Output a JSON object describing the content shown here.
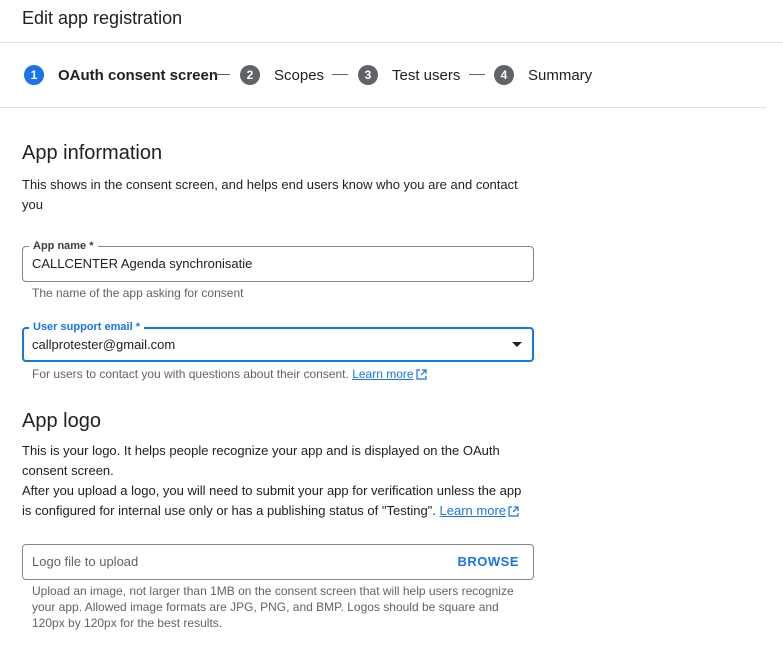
{
  "header": {
    "title": "Edit app registration"
  },
  "stepper": {
    "steps": [
      {
        "number": "1",
        "label": "OAuth consent screen",
        "active": true
      },
      {
        "number": "2",
        "label": "Scopes",
        "active": false
      },
      {
        "number": "3",
        "label": "Test users",
        "active": false
      },
      {
        "number": "4",
        "label": "Summary",
        "active": false
      }
    ]
  },
  "app_information": {
    "heading": "App information",
    "description": "This shows in the consent screen, and helps end users know who you are and contact you",
    "app_name": {
      "label": "App name *",
      "value": "CALLCENTER Agenda synchronisatie",
      "hint": "The name of the app asking for consent"
    },
    "support_email": {
      "label": "User support email *",
      "value": "callprotester@gmail.com",
      "hint": "For users to contact you with questions about their consent.",
      "learn_more": "Learn more"
    }
  },
  "app_logo": {
    "heading": "App logo",
    "description_1": "This is your logo. It helps people recognize your app and is displayed on the OAuth consent screen.",
    "description_2": "After you upload a logo, you will need to submit your app for verification unless the app is configured for internal use only or has a publishing status of \"Testing\".",
    "learn_more": "Learn more",
    "upload": {
      "placeholder": "Logo file to upload",
      "browse_label": "BROWSE",
      "hint": "Upload an image, not larger than 1MB on the consent screen that will help users recognize your app. Allowed image formats are JPG, PNG, and BMP. Logos should be square and 120px by 120px for the best results."
    }
  },
  "colors": {
    "accent": "#1a73e8",
    "step_inactive": "#5f6368",
    "hint_text": "#5f6368"
  }
}
